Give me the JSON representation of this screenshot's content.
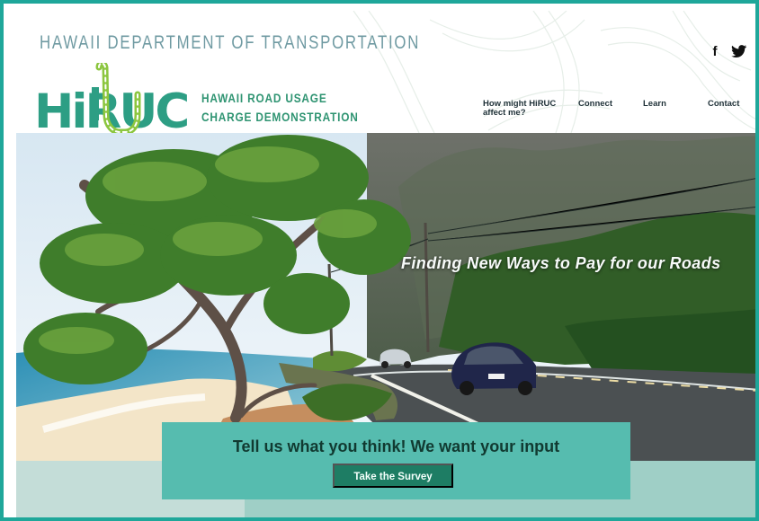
{
  "colors": {
    "frame": "#1fa79a",
    "brand_teal": "#2d9e84",
    "brand_green": "#8cc63f",
    "survey_panel": "#56bcaf",
    "survey_button": "#1e7d64"
  },
  "header": {
    "department": "HAWAII DEPARTMENT OF TRANSPORTATION",
    "logo_text": "HiRUC",
    "tagline_line1": "HAWAII ROAD USAGE",
    "tagline_line2": "CHARGE DEMONSTRATION",
    "social": {
      "facebook_icon": "facebook-icon",
      "twitter_icon": "twitter-icon",
      "facebook_glyph": "f"
    },
    "nav": [
      {
        "line1": "How might HiRUC",
        "line2": "affect me?"
      },
      {
        "label": "Connect"
      },
      {
        "label": "Learn"
      },
      {
        "label": "Contact"
      }
    ]
  },
  "hero": {
    "title": "Finding New Ways to Pay for our Roads",
    "image": "coastal road with tree, beach, mountain and cars"
  },
  "survey": {
    "title": "Tell us what you think! We want your input",
    "button_label": "Take the Survey"
  }
}
